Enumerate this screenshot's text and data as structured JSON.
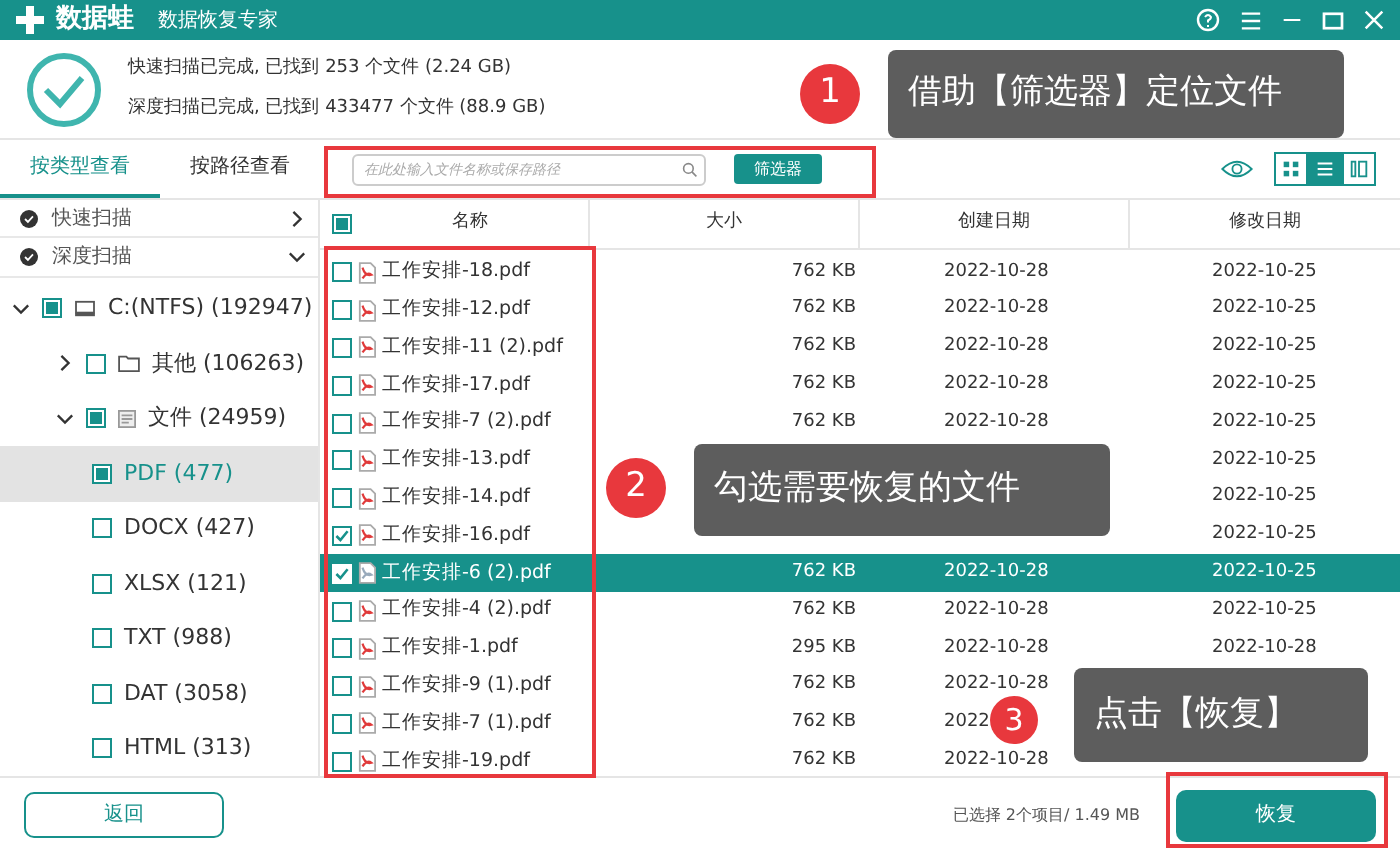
{
  "app": {
    "name": "数据蛙",
    "subtitle": "数据恢复专家"
  },
  "scan_summary": [
    "快速扫描已完成, 已找到 253 个文件 (2.24 GB)",
    "深度扫描已完成, 已找到 433477 个文件 (88.9 GB)"
  ],
  "view_tabs": [
    {
      "label": "按类型查看",
      "selected": true
    },
    {
      "label": "按路径查看",
      "selected": false
    }
  ],
  "search": {
    "placeholder": "在此处输入文件名称或保存路径"
  },
  "filter_button": "筛选器",
  "view_modes": [
    {
      "kind": "grid",
      "selected": false
    },
    {
      "kind": "list",
      "selected": true
    },
    {
      "kind": "columns",
      "selected": false
    }
  ],
  "scan_groups": [
    {
      "label": "快速扫描",
      "expanded": false
    },
    {
      "label": "深度扫描",
      "expanded": true
    }
  ],
  "tree": [
    {
      "label": "C:(NTFS) (192947)",
      "kind": "drive",
      "checked": false,
      "partial": true,
      "expanded": true,
      "selected": false,
      "children": [
        {
          "label": "其他 (106263)",
          "kind": "folder",
          "checked": false,
          "partial": false,
          "expanded": false,
          "selected": false
        },
        {
          "label": "文件 (24959)",
          "kind": "doc",
          "checked": false,
          "partial": true,
          "expanded": true,
          "selected": false,
          "children": [
            {
              "label": "PDF (477)",
              "checked": false,
              "partial": true,
              "selected": true
            },
            {
              "label": "DOCX (427)",
              "checked": false,
              "partial": false,
              "selected": false
            },
            {
              "label": "XLSX (121)",
              "checked": false,
              "partial": false,
              "selected": false
            },
            {
              "label": "TXT (988)",
              "checked": false,
              "partial": false,
              "selected": false
            },
            {
              "label": "DAT (3058)",
              "checked": false,
              "partial": false,
              "selected": false
            },
            {
              "label": "HTML (313)",
              "checked": false,
              "partial": false,
              "selected": false
            }
          ]
        }
      ]
    }
  ],
  "table": {
    "columns": [
      "名称",
      "大小",
      "创建日期",
      "修改日期"
    ],
    "header_checked": false,
    "header_partial": true,
    "rows": [
      {
        "name": "工作安排-18.pdf",
        "size": "762 KB",
        "created": "2022-10-28",
        "modified": "2022-10-25",
        "checked": false,
        "selected": false
      },
      {
        "name": "工作安排-12.pdf",
        "size": "762 KB",
        "created": "2022-10-28",
        "modified": "2022-10-25",
        "checked": false,
        "selected": false
      },
      {
        "name": "工作安排-11 (2).pdf",
        "size": "762 KB",
        "created": "2022-10-28",
        "modified": "2022-10-25",
        "checked": false,
        "selected": false
      },
      {
        "name": "工作安排-17.pdf",
        "size": "762 KB",
        "created": "2022-10-28",
        "modified": "2022-10-25",
        "checked": false,
        "selected": false
      },
      {
        "name": "工作安排-7 (2).pdf",
        "size": "762 KB",
        "created": "2022-10-28",
        "modified": "2022-10-25",
        "checked": false,
        "selected": false
      },
      {
        "name": "工作安排-13.pdf",
        "modified": "2022-10-25",
        "checked": false,
        "selected": false
      },
      {
        "name": "工作安排-14.pdf",
        "modified": "2022-10-25",
        "checked": false,
        "selected": false
      },
      {
        "name": "工作安排-16.pdf",
        "modified": "2022-10-25",
        "checked": true,
        "selected": false
      },
      {
        "name": "工作安排-6 (2).pdf",
        "size": "762 KB",
        "created": "2022-10-28",
        "modified": "2022-10-25",
        "checked": true,
        "selected": true
      },
      {
        "name": "工作安排-4 (2).pdf",
        "size": "762 KB",
        "created": "2022-10-28",
        "modified": "2022-10-25",
        "checked": false,
        "selected": false
      },
      {
        "name": "工作安排-1.pdf",
        "size": "295 KB",
        "created": "2022-10-28",
        "modified": "2022-10-28",
        "checked": false,
        "selected": false
      },
      {
        "name": "工作安排-9 (1).pdf",
        "size": "762 KB",
        "created": "2022-10-28",
        "checked": false,
        "selected": false
      },
      {
        "name": "工作安排-7 (1).pdf",
        "size": "762 KB",
        "created": "2022",
        "checked": false,
        "selected": false
      },
      {
        "name": "工作安排-19.pdf",
        "size": "762 KB",
        "created": "2022-10-28",
        "checked": false,
        "selected": false
      }
    ]
  },
  "footer": {
    "back_button": "返回",
    "selection_info": "已选择 2个项目/ 1.49 MB",
    "restore_button": "恢复"
  },
  "callouts": [
    {
      "number": "1",
      "text": "借助【筛选器】定位文件"
    },
    {
      "number": "2",
      "text": "勾选需要恢复的文件"
    },
    {
      "number": "3",
      "text": "点击【恢复】"
    }
  ]
}
